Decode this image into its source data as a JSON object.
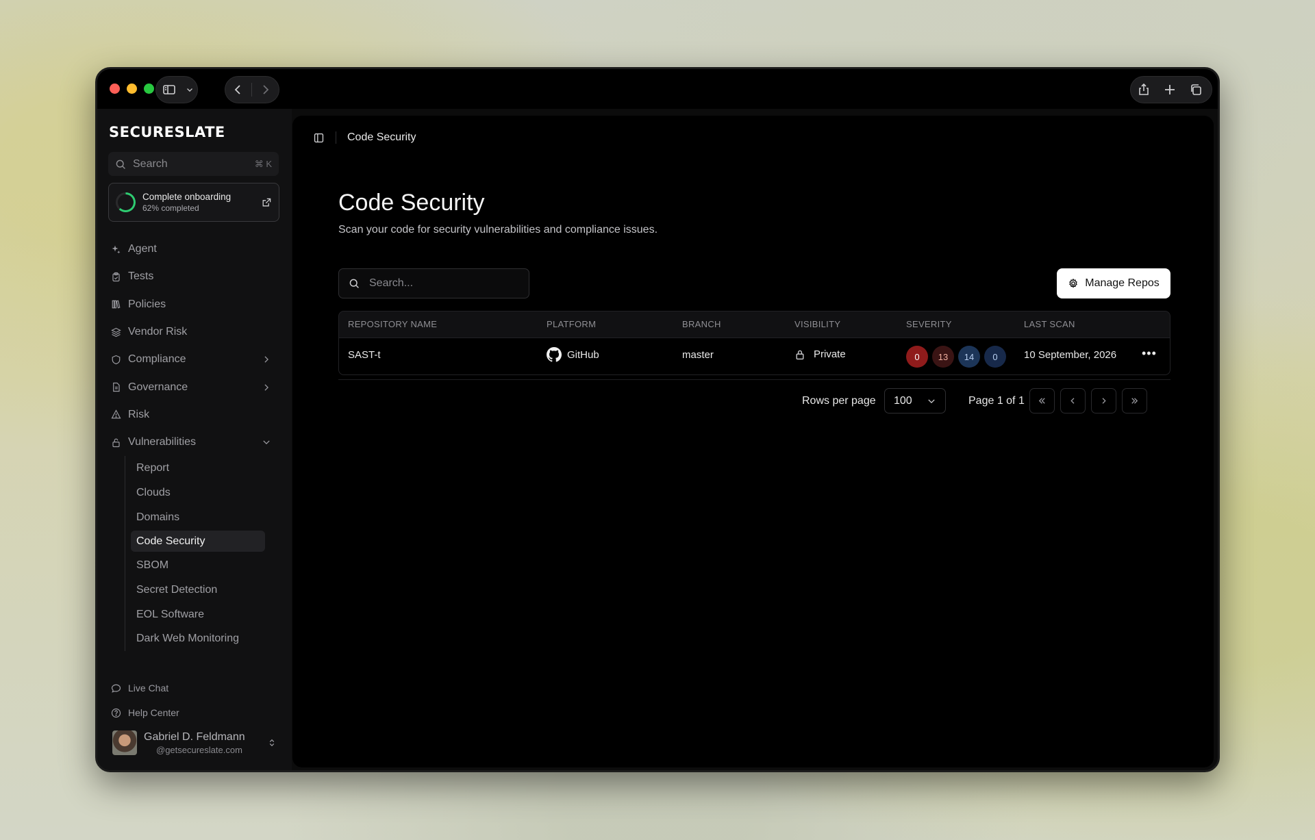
{
  "app": {
    "logo": "SECURESLATE"
  },
  "sidebar": {
    "search_label": "Search",
    "search_shortcut": "⌘ K",
    "onboarding": {
      "title": "Complete onboarding",
      "progress_text": "62% completed",
      "progress": 0.62
    },
    "items": [
      {
        "label": "Agent",
        "icon": "sparkle-icon"
      },
      {
        "label": "Tests",
        "icon": "clipboard-icon"
      },
      {
        "label": "Policies",
        "icon": "library-icon"
      },
      {
        "label": "Vendor Risk",
        "icon": "layers-icon"
      },
      {
        "label": "Compliance",
        "icon": "shield-icon"
      },
      {
        "label": "Governance",
        "icon": "document-icon"
      },
      {
        "label": "Risk",
        "icon": "warning-icon"
      },
      {
        "label": "Vulnerabilities",
        "icon": "lock-open-icon"
      }
    ],
    "subitems": [
      "Report",
      "Clouds",
      "Domains",
      "Code Security",
      "SBOM",
      "Secret Detection",
      "EOL Software",
      "Dark Web Monitoring"
    ],
    "active_subitem": "Code Security",
    "footer": {
      "live_chat": "Live Chat",
      "help_center": "Help Center"
    },
    "user": {
      "name": "Gabriel D. Feldmann",
      "email": "@getsecureslate.com"
    }
  },
  "breadcrumb": {
    "current": "Code Security"
  },
  "page": {
    "title": "Code Security",
    "subtitle": "Scan your code for security vulnerabilities and compliance issues.",
    "search_placeholder": "Search...",
    "manage_button": "Manage Repos"
  },
  "table": {
    "columns": [
      "REPOSITORY NAME",
      "PLATFORM",
      "BRANCH",
      "VISIBILITY",
      "SEVERITY",
      "LAST SCAN"
    ],
    "rows": [
      {
        "repository": "SAST-t",
        "platform": "GitHub",
        "branch": "master",
        "visibility": "Private",
        "severity": {
          "critical": "0",
          "high": "13",
          "medium": "14",
          "low": "0"
        },
        "last_scan": "10 September, 2026"
      }
    ]
  },
  "pagination": {
    "rows_per_page_label": "Rows per page",
    "rows_per_page": "100",
    "page_text": "Page 1 of 1"
  },
  "colors": {
    "accent_green": "#2ecc71",
    "critical": "#8f1b1b",
    "high": "#3a1414",
    "medium": "#1c3558",
    "low": "#17294a"
  }
}
